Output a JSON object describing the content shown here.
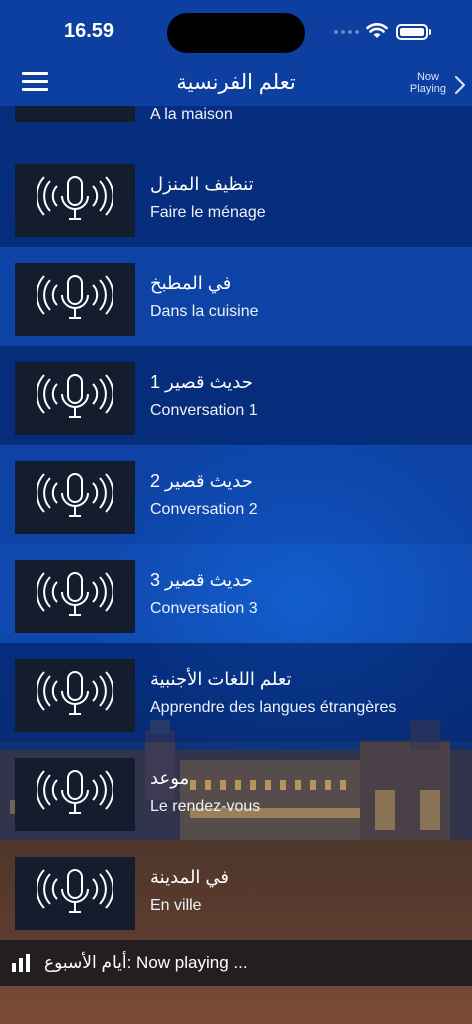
{
  "status": {
    "time": "16.59"
  },
  "nav": {
    "title": "تعلم الفرنسية",
    "now_playing_line1": "Now",
    "now_playing_line2": "Playing"
  },
  "list": {
    "partial_item": {
      "subtitle": "A la maison"
    },
    "items": [
      {
        "title": "تنظيف المنزل",
        "subtitle": "Faire le ménage"
      },
      {
        "title": "في المطبخ",
        "subtitle": "Dans la cuisine"
      },
      {
        "title": "حديث قصير 1",
        "subtitle": "Conversation 1"
      },
      {
        "title": "حديث قصير 2",
        "subtitle": "Conversation 2"
      },
      {
        "title": "حديث قصير 3",
        "subtitle": "Conversation 3"
      },
      {
        "title": "تعلم اللغات الأجنبية",
        "subtitle": "Apprendre des langues étrangères"
      },
      {
        "title": "موعد",
        "subtitle": "Le rendez-vous"
      },
      {
        "title": "في المدينة",
        "subtitle": "En ville"
      }
    ],
    "thumbnail_icon": "microphone-broadcast-icon"
  },
  "player": {
    "text": "أيام الأسبوع: Now playing ...",
    "icon": "audio-bars-icon"
  }
}
